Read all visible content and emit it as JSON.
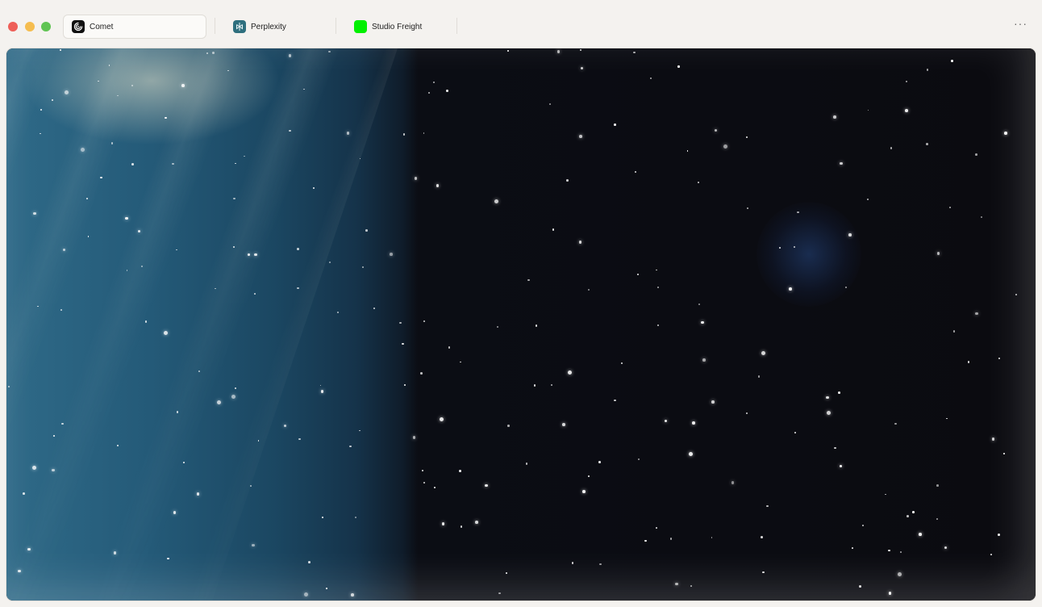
{
  "window": {
    "controls": [
      "close",
      "minimize",
      "zoom"
    ],
    "more_label": "···"
  },
  "tabs": [
    {
      "label": "Comet",
      "icon": "comet-icon",
      "active": true,
      "color": "#111111"
    },
    {
      "label": "Perplexity",
      "icon": "perplexity-icon",
      "active": false,
      "color": "#2e6f7e"
    },
    {
      "label": "Studio Freight",
      "icon": "studio-freight-icon",
      "active": false,
      "color": "#00f000"
    }
  ],
  "page": {
    "scene": "starfield",
    "colors": {
      "sky": "#0b0b10",
      "blue": "#2f6a88"
    }
  }
}
